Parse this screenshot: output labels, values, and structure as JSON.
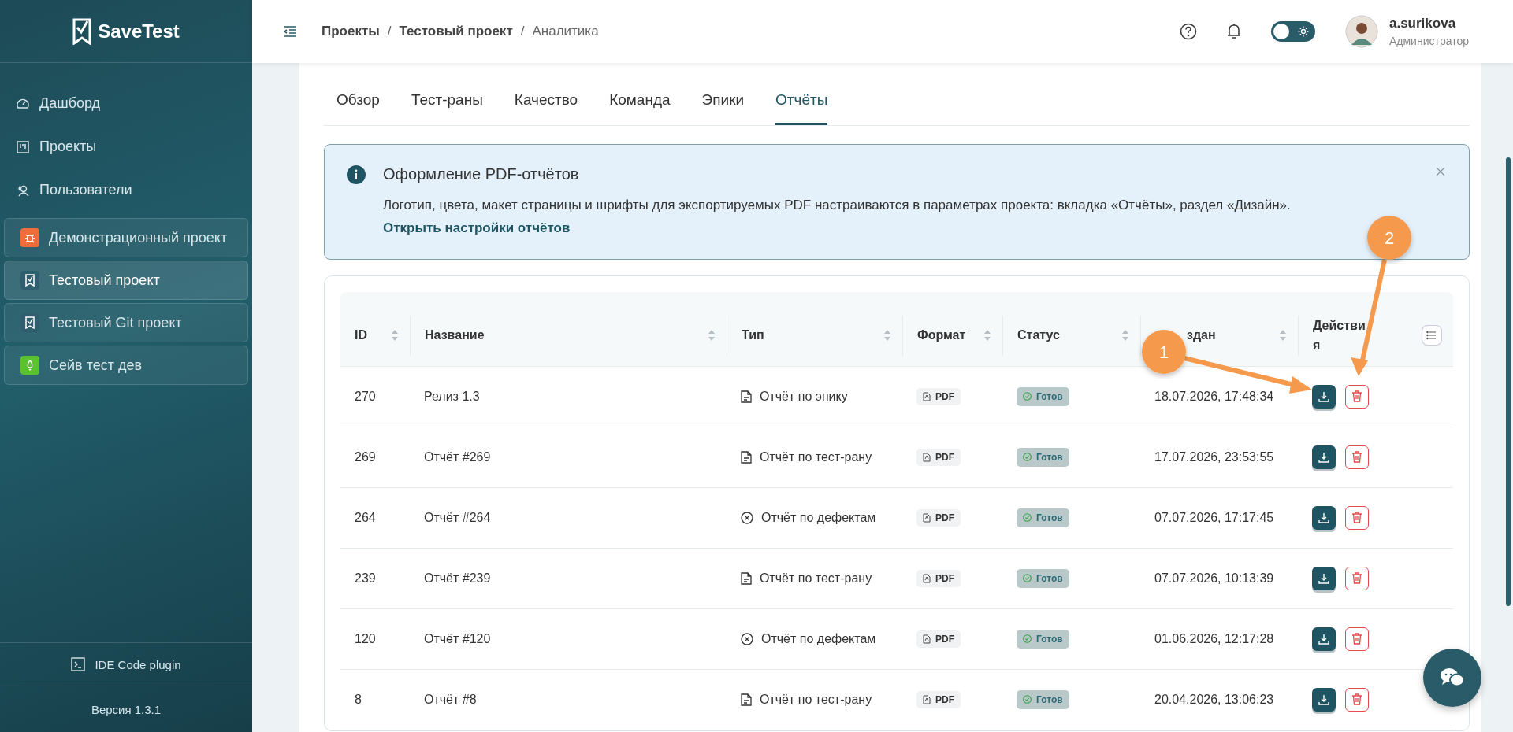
{
  "sidebar": {
    "logo": "SaveTest",
    "nav": [
      {
        "label": "Дашборд",
        "kind": "dashboard"
      },
      {
        "label": "Проекты",
        "kind": "projects"
      },
      {
        "label": "Пользователи",
        "kind": "users"
      }
    ],
    "projects": [
      {
        "label": "Демонстрационный проект",
        "kind": "bug",
        "color": "#f26b3a",
        "selected": false
      },
      {
        "label": "Тестовый проект",
        "kind": "check",
        "color": "#2f5f6e",
        "selected": true
      },
      {
        "label": "Тестовый Git проект",
        "kind": "check",
        "color": "#2f5f6e",
        "selected": false
      },
      {
        "label": "Сейв тест дев",
        "kind": "rocket",
        "color": "#5ac12f",
        "selected": false
      }
    ],
    "plugin": "IDE Code plugin",
    "version": "Версия 1.3.1"
  },
  "header": {
    "breadcrumbs": [
      {
        "label": "Проекты",
        "current": false
      },
      {
        "label": "Тестовый проект",
        "current": false
      },
      {
        "label": "Аналитика",
        "current": true
      }
    ],
    "separator": "/",
    "theme_toggle": {
      "on": false
    },
    "user": {
      "name": "a.surikova",
      "role": "Администратор"
    }
  },
  "tabs": [
    {
      "label": "Обзор",
      "selected": false
    },
    {
      "label": "Тест-раны",
      "selected": false
    },
    {
      "label": "Качество",
      "selected": false
    },
    {
      "label": "Команда",
      "selected": false
    },
    {
      "label": "Эпики",
      "selected": false
    },
    {
      "label": "Отчёты",
      "selected": true
    }
  ],
  "banner": {
    "title": "Оформление PDF-отчётов",
    "text": "Логотип, цвета, макет страницы и шрифты для экспортируемых PDF настраиваются в параметрах проекта: вкладка «Отчёты», раздел «Дизайн».",
    "link": "Открыть настройки отчётов"
  },
  "table": {
    "columns": [
      {
        "label": "ID",
        "sortable": true
      },
      {
        "label": "Название",
        "sortable": true
      },
      {
        "label": "Тип",
        "sortable": true
      },
      {
        "label": "Формат",
        "sortable": true
      },
      {
        "label": "Статус",
        "sortable": true
      },
      {
        "label": "здан",
        "sortable": true
      },
      {
        "label": "Действия",
        "sortable": false
      }
    ],
    "rows": [
      {
        "id": "270",
        "name": "Релиз 1.3",
        "type": {
          "kind": "doc",
          "label": "Отчёт по эпику"
        },
        "format": "PDF",
        "status": {
          "kind": "ready",
          "label": "Готов"
        },
        "created": "18.07.2026, 17:48:34"
      },
      {
        "id": "269",
        "name": "Отчёт #269",
        "type": {
          "kind": "doc",
          "label": "Отчёт по тест-рану"
        },
        "format": "PDF",
        "status": {
          "kind": "ready",
          "label": "Готов"
        },
        "created": "17.07.2026, 23:53:55"
      },
      {
        "id": "264",
        "name": "Отчёт #264",
        "type": {
          "kind": "defect",
          "label": "Отчёт по дефектам"
        },
        "format": "PDF",
        "status": {
          "kind": "ready",
          "label": "Готов"
        },
        "created": "07.07.2026, 17:17:45"
      },
      {
        "id": "239",
        "name": "Отчёт #239",
        "type": {
          "kind": "doc",
          "label": "Отчёт по тест-рану"
        },
        "format": "PDF",
        "status": {
          "kind": "ready",
          "label": "Готов"
        },
        "created": "07.07.2026, 10:13:39"
      },
      {
        "id": "120",
        "name": "Отчёт #120",
        "type": {
          "kind": "defect",
          "label": "Отчёт по дефектам"
        },
        "format": "PDF",
        "status": {
          "kind": "ready",
          "label": "Готов"
        },
        "created": "01.06.2026, 12:17:28"
      },
      {
        "id": "8",
        "name": "Отчёт #8",
        "type": {
          "kind": "doc",
          "label": "Отчёт по тест-рану"
        },
        "format": "PDF",
        "status": {
          "kind": "ready",
          "label": "Готов"
        },
        "created": "20.04.2026, 13:06:23"
      }
    ]
  },
  "annotations": [
    {
      "label": "1"
    },
    {
      "label": "2"
    }
  ]
}
